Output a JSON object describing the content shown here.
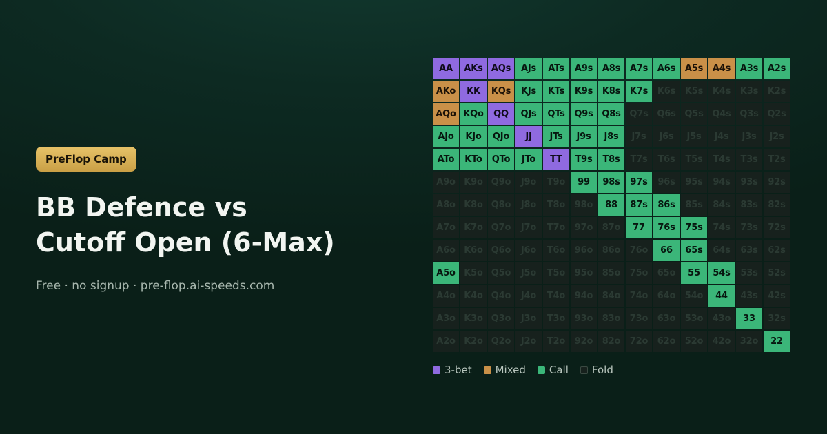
{
  "badge": "PreFlop Camp",
  "title": {
    "line1": "BB Defence vs",
    "line2": "Cutoff Open (6-Max)"
  },
  "subtitle": "Free · no signup · pre-flop.ai-speeds.com",
  "colors": {
    "3bet": "#8f6ae0",
    "mixed": "#c99048",
    "call": "#3bb679",
    "fold": "#17211d",
    "badge": "#d9b457"
  },
  "legend": [
    {
      "key": "3bet",
      "label": "3-bet"
    },
    {
      "key": "mixed",
      "label": "Mixed"
    },
    {
      "key": "call",
      "label": "Call"
    },
    {
      "key": "fold",
      "label": "Fold"
    }
  ],
  "grid": [
    [
      {
        "h": "AA",
        "a": "3bet"
      },
      {
        "h": "AKs",
        "a": "3bet"
      },
      {
        "h": "AQs",
        "a": "3bet"
      },
      {
        "h": "AJs",
        "a": "call"
      },
      {
        "h": "ATs",
        "a": "call"
      },
      {
        "h": "A9s",
        "a": "call"
      },
      {
        "h": "A8s",
        "a": "call"
      },
      {
        "h": "A7s",
        "a": "call"
      },
      {
        "h": "A6s",
        "a": "call"
      },
      {
        "h": "A5s",
        "a": "mixed"
      },
      {
        "h": "A4s",
        "a": "mixed"
      },
      {
        "h": "A3s",
        "a": "call"
      },
      {
        "h": "A2s",
        "a": "call"
      }
    ],
    [
      {
        "h": "AKo",
        "a": "mixed"
      },
      {
        "h": "KK",
        "a": "3bet"
      },
      {
        "h": "KQs",
        "a": "mixed"
      },
      {
        "h": "KJs",
        "a": "call"
      },
      {
        "h": "KTs",
        "a": "call"
      },
      {
        "h": "K9s",
        "a": "call"
      },
      {
        "h": "K8s",
        "a": "call"
      },
      {
        "h": "K7s",
        "a": "call"
      },
      {
        "h": "K6s",
        "a": "fold"
      },
      {
        "h": "K5s",
        "a": "fold"
      },
      {
        "h": "K4s",
        "a": "fold"
      },
      {
        "h": "K3s",
        "a": "fold"
      },
      {
        "h": "K2s",
        "a": "fold"
      }
    ],
    [
      {
        "h": "AQo",
        "a": "mixed"
      },
      {
        "h": "KQo",
        "a": "call"
      },
      {
        "h": "QQ",
        "a": "3bet"
      },
      {
        "h": "QJs",
        "a": "call"
      },
      {
        "h": "QTs",
        "a": "call"
      },
      {
        "h": "Q9s",
        "a": "call"
      },
      {
        "h": "Q8s",
        "a": "call"
      },
      {
        "h": "Q7s",
        "a": "fold"
      },
      {
        "h": "Q6s",
        "a": "fold"
      },
      {
        "h": "Q5s",
        "a": "fold"
      },
      {
        "h": "Q4s",
        "a": "fold"
      },
      {
        "h": "Q3s",
        "a": "fold"
      },
      {
        "h": "Q2s",
        "a": "fold"
      }
    ],
    [
      {
        "h": "AJo",
        "a": "call"
      },
      {
        "h": "KJo",
        "a": "call"
      },
      {
        "h": "QJo",
        "a": "call"
      },
      {
        "h": "JJ",
        "a": "3bet"
      },
      {
        "h": "JTs",
        "a": "call"
      },
      {
        "h": "J9s",
        "a": "call"
      },
      {
        "h": "J8s",
        "a": "call"
      },
      {
        "h": "J7s",
        "a": "fold"
      },
      {
        "h": "J6s",
        "a": "fold"
      },
      {
        "h": "J5s",
        "a": "fold"
      },
      {
        "h": "J4s",
        "a": "fold"
      },
      {
        "h": "J3s",
        "a": "fold"
      },
      {
        "h": "J2s",
        "a": "fold"
      }
    ],
    [
      {
        "h": "ATo",
        "a": "call"
      },
      {
        "h": "KTo",
        "a": "call"
      },
      {
        "h": "QTo",
        "a": "call"
      },
      {
        "h": "JTo",
        "a": "call"
      },
      {
        "h": "TT",
        "a": "3bet"
      },
      {
        "h": "T9s",
        "a": "call"
      },
      {
        "h": "T8s",
        "a": "call"
      },
      {
        "h": "T7s",
        "a": "fold"
      },
      {
        "h": "T6s",
        "a": "fold"
      },
      {
        "h": "T5s",
        "a": "fold"
      },
      {
        "h": "T4s",
        "a": "fold"
      },
      {
        "h": "T3s",
        "a": "fold"
      },
      {
        "h": "T2s",
        "a": "fold"
      }
    ],
    [
      {
        "h": "A9o",
        "a": "fold"
      },
      {
        "h": "K9o",
        "a": "fold"
      },
      {
        "h": "Q9o",
        "a": "fold"
      },
      {
        "h": "J9o",
        "a": "fold"
      },
      {
        "h": "T9o",
        "a": "fold"
      },
      {
        "h": "99",
        "a": "call"
      },
      {
        "h": "98s",
        "a": "call"
      },
      {
        "h": "97s",
        "a": "call"
      },
      {
        "h": "96s",
        "a": "fold"
      },
      {
        "h": "95s",
        "a": "fold"
      },
      {
        "h": "94s",
        "a": "fold"
      },
      {
        "h": "93s",
        "a": "fold"
      },
      {
        "h": "92s",
        "a": "fold"
      }
    ],
    [
      {
        "h": "A8o",
        "a": "fold"
      },
      {
        "h": "K8o",
        "a": "fold"
      },
      {
        "h": "Q8o",
        "a": "fold"
      },
      {
        "h": "J8o",
        "a": "fold"
      },
      {
        "h": "T8o",
        "a": "fold"
      },
      {
        "h": "98o",
        "a": "fold"
      },
      {
        "h": "88",
        "a": "call"
      },
      {
        "h": "87s",
        "a": "call"
      },
      {
        "h": "86s",
        "a": "call"
      },
      {
        "h": "85s",
        "a": "fold"
      },
      {
        "h": "84s",
        "a": "fold"
      },
      {
        "h": "83s",
        "a": "fold"
      },
      {
        "h": "82s",
        "a": "fold"
      }
    ],
    [
      {
        "h": "A7o",
        "a": "fold"
      },
      {
        "h": "K7o",
        "a": "fold"
      },
      {
        "h": "Q7o",
        "a": "fold"
      },
      {
        "h": "J7o",
        "a": "fold"
      },
      {
        "h": "T7o",
        "a": "fold"
      },
      {
        "h": "97o",
        "a": "fold"
      },
      {
        "h": "87o",
        "a": "fold"
      },
      {
        "h": "77",
        "a": "call"
      },
      {
        "h": "76s",
        "a": "call"
      },
      {
        "h": "75s",
        "a": "call"
      },
      {
        "h": "74s",
        "a": "fold"
      },
      {
        "h": "73s",
        "a": "fold"
      },
      {
        "h": "72s",
        "a": "fold"
      }
    ],
    [
      {
        "h": "A6o",
        "a": "fold"
      },
      {
        "h": "K6o",
        "a": "fold"
      },
      {
        "h": "Q6o",
        "a": "fold"
      },
      {
        "h": "J6o",
        "a": "fold"
      },
      {
        "h": "T6o",
        "a": "fold"
      },
      {
        "h": "96o",
        "a": "fold"
      },
      {
        "h": "86o",
        "a": "fold"
      },
      {
        "h": "76o",
        "a": "fold"
      },
      {
        "h": "66",
        "a": "call"
      },
      {
        "h": "65s",
        "a": "call"
      },
      {
        "h": "64s",
        "a": "fold"
      },
      {
        "h": "63s",
        "a": "fold"
      },
      {
        "h": "62s",
        "a": "fold"
      }
    ],
    [
      {
        "h": "A5o",
        "a": "call"
      },
      {
        "h": "K5o",
        "a": "fold"
      },
      {
        "h": "Q5o",
        "a": "fold"
      },
      {
        "h": "J5o",
        "a": "fold"
      },
      {
        "h": "T5o",
        "a": "fold"
      },
      {
        "h": "95o",
        "a": "fold"
      },
      {
        "h": "85o",
        "a": "fold"
      },
      {
        "h": "75o",
        "a": "fold"
      },
      {
        "h": "65o",
        "a": "fold"
      },
      {
        "h": "55",
        "a": "call"
      },
      {
        "h": "54s",
        "a": "call"
      },
      {
        "h": "53s",
        "a": "fold"
      },
      {
        "h": "52s",
        "a": "fold"
      }
    ],
    [
      {
        "h": "A4o",
        "a": "fold"
      },
      {
        "h": "K4o",
        "a": "fold"
      },
      {
        "h": "Q4o",
        "a": "fold"
      },
      {
        "h": "J4o",
        "a": "fold"
      },
      {
        "h": "T4o",
        "a": "fold"
      },
      {
        "h": "94o",
        "a": "fold"
      },
      {
        "h": "84o",
        "a": "fold"
      },
      {
        "h": "74o",
        "a": "fold"
      },
      {
        "h": "64o",
        "a": "fold"
      },
      {
        "h": "54o",
        "a": "fold"
      },
      {
        "h": "44",
        "a": "call"
      },
      {
        "h": "43s",
        "a": "fold"
      },
      {
        "h": "42s",
        "a": "fold"
      }
    ],
    [
      {
        "h": "A3o",
        "a": "fold"
      },
      {
        "h": "K3o",
        "a": "fold"
      },
      {
        "h": "Q3o",
        "a": "fold"
      },
      {
        "h": "J3o",
        "a": "fold"
      },
      {
        "h": "T3o",
        "a": "fold"
      },
      {
        "h": "93o",
        "a": "fold"
      },
      {
        "h": "83o",
        "a": "fold"
      },
      {
        "h": "73o",
        "a": "fold"
      },
      {
        "h": "63o",
        "a": "fold"
      },
      {
        "h": "53o",
        "a": "fold"
      },
      {
        "h": "43o",
        "a": "fold"
      },
      {
        "h": "33",
        "a": "call"
      },
      {
        "h": "32s",
        "a": "fold"
      }
    ],
    [
      {
        "h": "A2o",
        "a": "fold"
      },
      {
        "h": "K2o",
        "a": "fold"
      },
      {
        "h": "Q2o",
        "a": "fold"
      },
      {
        "h": "J2o",
        "a": "fold"
      },
      {
        "h": "T2o",
        "a": "fold"
      },
      {
        "h": "92o",
        "a": "fold"
      },
      {
        "h": "82o",
        "a": "fold"
      },
      {
        "h": "72o",
        "a": "fold"
      },
      {
        "h": "62o",
        "a": "fold"
      },
      {
        "h": "52o",
        "a": "fold"
      },
      {
        "h": "42o",
        "a": "fold"
      },
      {
        "h": "32o",
        "a": "fold"
      },
      {
        "h": "22",
        "a": "call"
      }
    ]
  ]
}
